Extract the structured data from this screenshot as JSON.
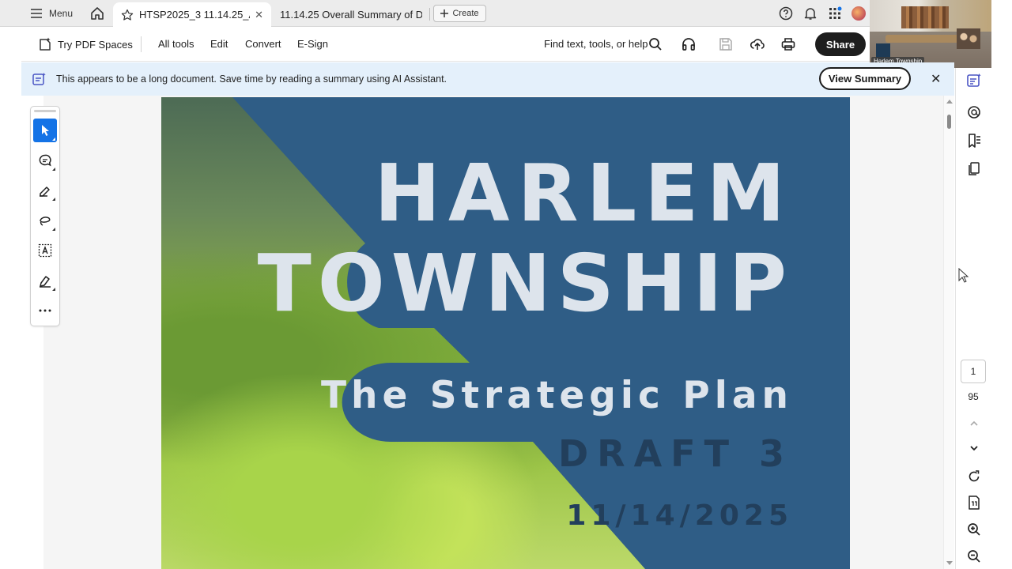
{
  "tabbar": {
    "menu_label": "Menu",
    "tabs": [
      {
        "title": "HTSP2025_3 11.14.25_A...",
        "active": true
      },
      {
        "title": "11.14.25 Overall Summary of Dr...",
        "active": false
      }
    ],
    "create_label": "Create"
  },
  "toolbar": {
    "pdf_spaces_label": "Try PDF Spaces",
    "menu_items": [
      "All tools",
      "Edit",
      "Convert",
      "E-Sign"
    ],
    "find_label": "Find text, tools, or help",
    "share_label": "Share"
  },
  "banner": {
    "message": "This appears to be a long document. Save time by reading a summary using AI Assistant.",
    "button_label": "View Summary",
    "close_label": "✕"
  },
  "document": {
    "title_line1": "HARLEM",
    "title_line2": "TOWNSHIP",
    "subtitle": "The Strategic Plan",
    "draft": "DRAFT 3",
    "date": "11/14/2025",
    "theme_color": "#2f5d86"
  },
  "video": {
    "label": "Harlem Township"
  },
  "navigation": {
    "current_page": "1",
    "total_pages": "95"
  },
  "colors": {
    "accent": "#1473e6",
    "banner_bg": "#e4f0fb",
    "share_bg": "#1d1d1d"
  }
}
